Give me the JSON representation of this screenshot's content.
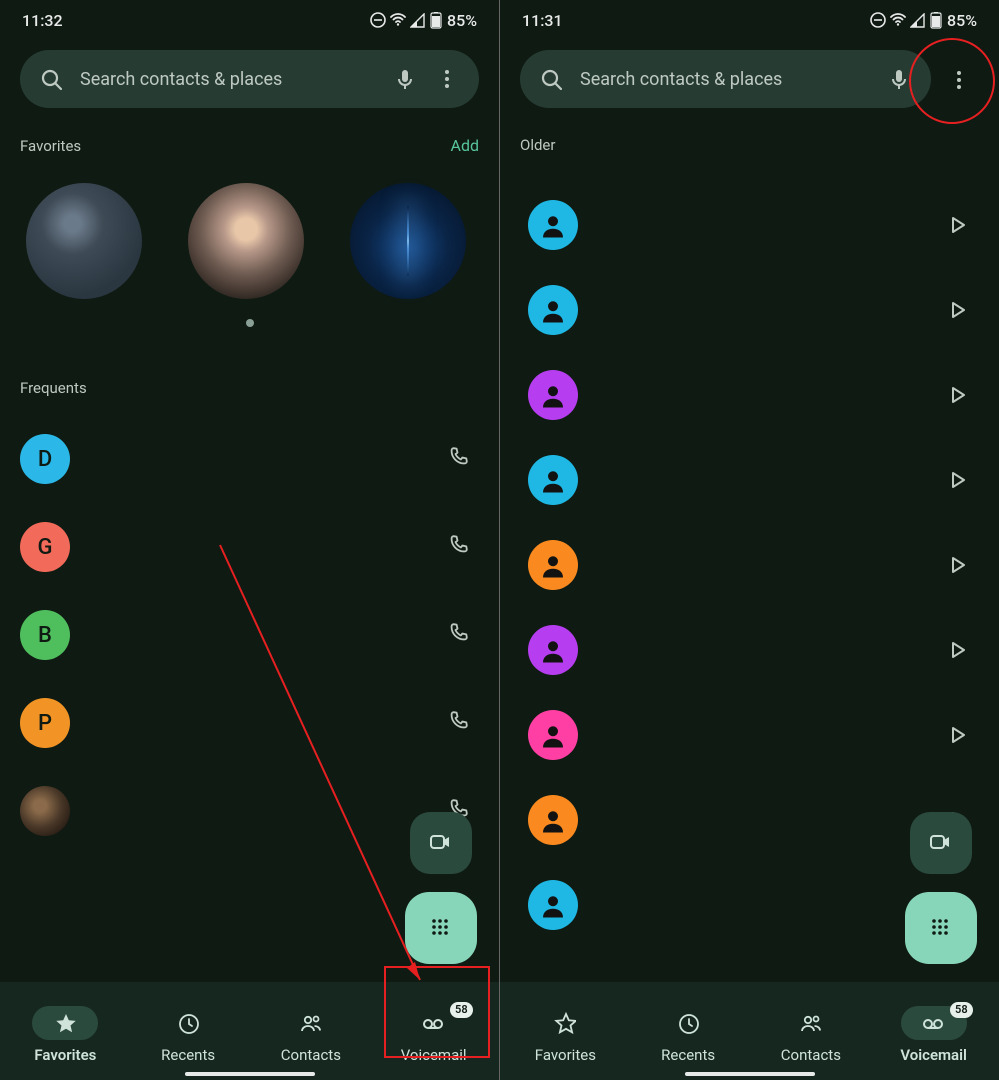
{
  "left": {
    "status": {
      "time": "11:32",
      "battery": "85%"
    },
    "search_placeholder": "Search contacts & places",
    "favorites_header": "Favorites",
    "add_label": "Add",
    "frequents_header": "Frequents",
    "frequents": [
      {
        "letter": "D",
        "color": "#2bb8e8"
      },
      {
        "letter": "G",
        "color": "#f26a5a"
      },
      {
        "letter": "B",
        "color": "#4fbf5e"
      },
      {
        "letter": "P",
        "color": "#f29425"
      },
      {
        "letter": "",
        "color": "photo"
      }
    ],
    "nav": {
      "favorites": "Favorites",
      "recents": "Recents",
      "contacts": "Contacts",
      "voicemail": "Voicemail",
      "voicemail_badge": "58",
      "active": 0
    }
  },
  "right": {
    "status": {
      "time": "11:31",
      "battery": "85%"
    },
    "search_placeholder": "Search contacts & places",
    "older_header": "Older",
    "voicemails": [
      {
        "color": "#1fb8e5"
      },
      {
        "color": "#1fb8e5"
      },
      {
        "color": "#b63ef0"
      },
      {
        "color": "#1fb8e5"
      },
      {
        "color": "#fa8a1f"
      },
      {
        "color": "#b63ef0"
      },
      {
        "color": "#ff3fa3"
      },
      {
        "color": "#fa8a1f"
      },
      {
        "color": "#1fb8e5"
      }
    ],
    "nav": {
      "favorites": "Favorites",
      "recents": "Recents",
      "contacts": "Contacts",
      "voicemail": "Voicemail",
      "voicemail_badge": "58",
      "active": 3
    }
  }
}
